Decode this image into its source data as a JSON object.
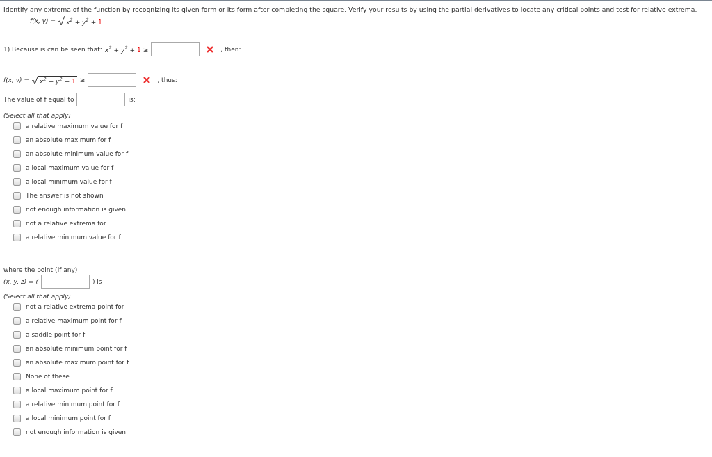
{
  "instructions": "Identify any extrema of the function by recognizing its given form or its form after completing the square. Verify your results by using the partial derivatives to locate any critical points and test for relative extrema.",
  "function": {
    "lhs": "f(x, y) =",
    "radicand": "x$^{2}$ + y$^{2}$ +",
    "constant": "1"
  },
  "step1": {
    "lead": "1) Because is can be seen that:",
    "expr": "x$^{2}$ + y$^{2}$ +",
    "constant": "1",
    "relation": "≥",
    "correct": false,
    "after": ", then:"
  },
  "step2": {
    "lhs": "f(x, y) =",
    "radicand": "x$^{2}$ + y$^{2}$ +",
    "constant": "1",
    "relation": "≥",
    "correct": false,
    "after": ", thus:"
  },
  "value_line": {
    "lead": "The value of f equal to",
    "after": "is:"
  },
  "group1": {
    "hint": "(Select all that apply)",
    "options": [
      {
        "label": "a relative maximum value for f",
        "checked": false
      },
      {
        "label": "an absolute maximum for f",
        "checked": false
      },
      {
        "label": "an absolute minimum value for f",
        "checked": false
      },
      {
        "label": "a local maximum value for f",
        "checked": false
      },
      {
        "label": "a local minimum value for f",
        "checked": false
      },
      {
        "label": "The answer is not shown",
        "checked": false
      },
      {
        "label": "not enough information is given",
        "checked": false
      },
      {
        "label": "not a relative extrema for",
        "checked": false
      },
      {
        "label": "a relative minimum value for f",
        "checked": false
      }
    ]
  },
  "point_line": {
    "lead": "where the point:(if any)",
    "tuple": "(x, y, z) = (",
    "after": ") is"
  },
  "group2": {
    "hint": "(Select all that apply)",
    "options": [
      {
        "label": "not a relative extrema point for",
        "checked": false
      },
      {
        "label": "a relative maximum point for f",
        "checked": false
      },
      {
        "label": "a saddle point for f",
        "checked": false
      },
      {
        "label": "an absolute minimum point for f",
        "checked": false
      },
      {
        "label": "an absolute maximum point for f",
        "checked": false
      },
      {
        "label": "None of these",
        "checked": false
      },
      {
        "label": "a local maximum point for f",
        "checked": false
      },
      {
        "label": "a relative minimum point for f",
        "checked": false
      },
      {
        "label": "a local minimum point for f",
        "checked": false
      },
      {
        "label": "not enough information is given",
        "checked": false
      }
    ]
  }
}
